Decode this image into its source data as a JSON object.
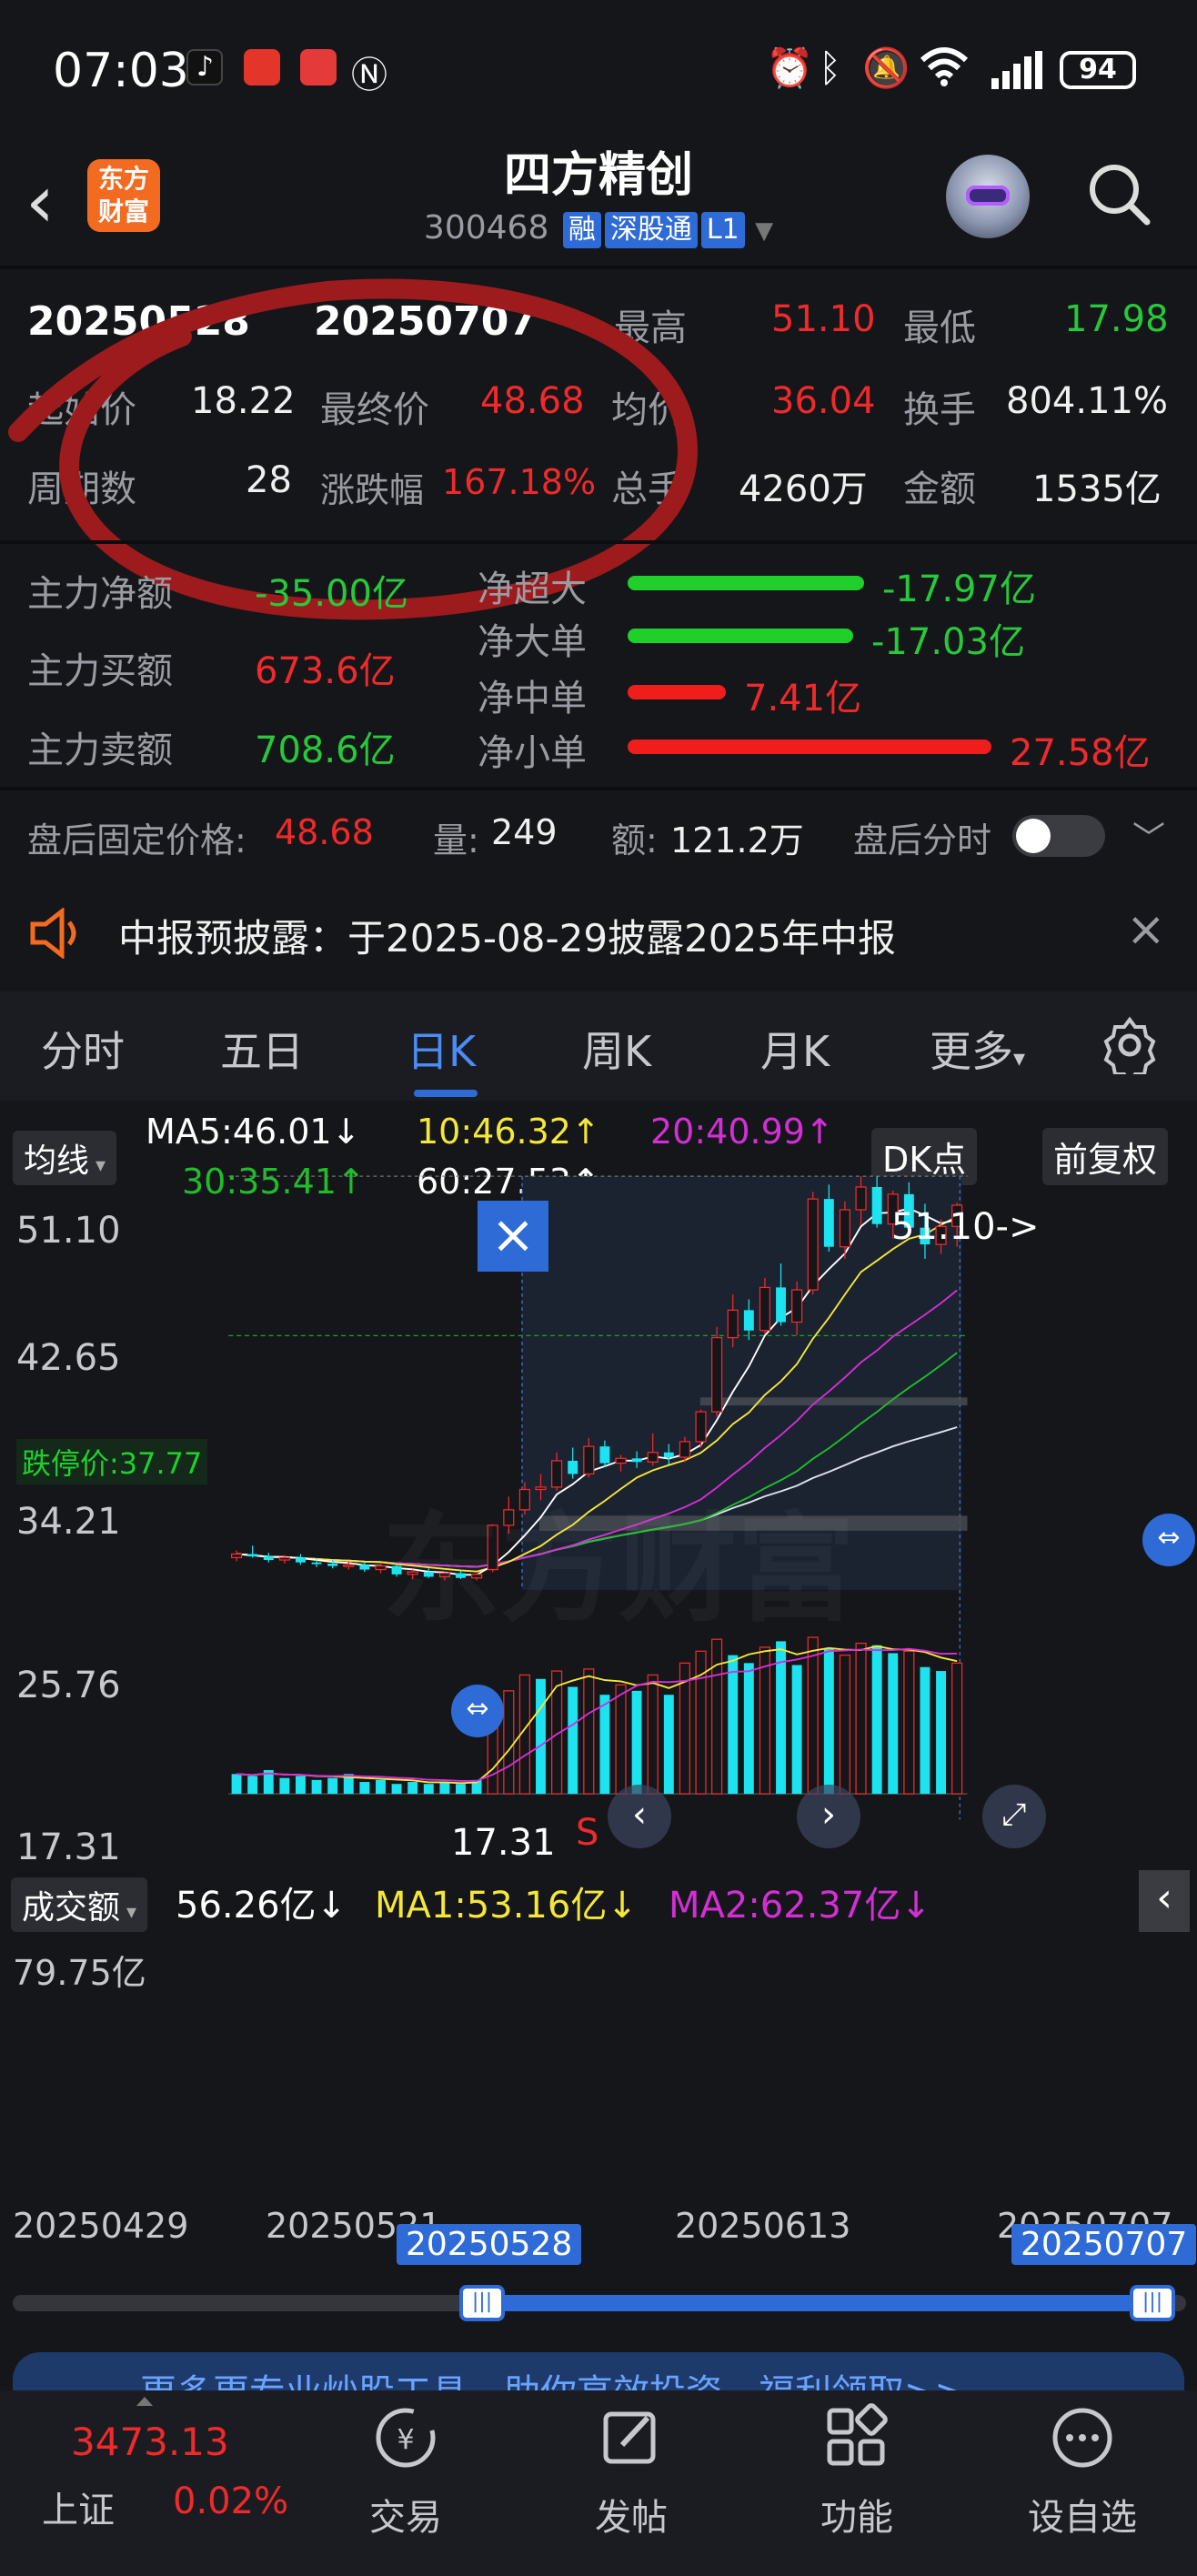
{
  "status_bar": {
    "time": "07:03",
    "battery": "94",
    "icons": [
      "tiktok-icon",
      "huawei-app-icon",
      "red-app-icon",
      "nfc-icon",
      "alarm-icon",
      "bluetooth-icon",
      "mute-icon",
      "wifi-icon",
      "signal-icon"
    ]
  },
  "header": {
    "logo_line1": "东方",
    "logo_line2": "财富",
    "title": "四方精创",
    "code": "300468",
    "tags": [
      "融",
      "深股通",
      "L1"
    ]
  },
  "period_stats": {
    "start_date": "20250528",
    "end_date": "20250707",
    "high_label": "最高",
    "high_value": "51.10",
    "low_label": "最低",
    "low_value": "17.98",
    "start_price_label": "起始价",
    "start_price_value": "18.22",
    "final_price_label": "最终价",
    "final_price_value": "48.68",
    "avg_label": "均价",
    "avg_value": "36.04",
    "turnover_label": "换手",
    "turnover_value": "804.11%",
    "days_label": "周期数",
    "days_value": "28",
    "change_label": "涨跌幅",
    "change_value": "167.18%",
    "volume_label": "总手",
    "volume_value": "4260万",
    "amount_label": "金额",
    "amount_value": "1535亿"
  },
  "capital_flow": {
    "net_label": "主力净额",
    "net_value": "-35.00亿",
    "buy_label": "主力买额",
    "buy_value": "673.6亿",
    "sell_label": "主力卖额",
    "sell_value": "708.6亿",
    "items": [
      {
        "label": "净超大",
        "value": "-17.97亿",
        "color": "#1fd02a",
        "ratio": 0.65
      },
      {
        "label": "净大单",
        "value": "-17.03亿",
        "color": "#1fd02a",
        "ratio": 0.62
      },
      {
        "label": "净中单",
        "value": "7.41亿",
        "color": "#f01d1d",
        "ratio": 0.27
      },
      {
        "label": "净小单",
        "value": "27.58亿",
        "color": "#f01d1d",
        "ratio": 1.0
      }
    ]
  },
  "after_hours": {
    "price_label": "盘后固定价格:",
    "price_value": "48.68",
    "vol_label": "量:",
    "vol_value": "249",
    "amt_label": "额:",
    "amt_value": "121.2万",
    "timeshare_label": "盘后分时"
  },
  "notice": {
    "text": "中报预披露：于2025-08-29披露2025年中报"
  },
  "tabs": [
    "分时",
    "五日",
    "日K",
    "周K",
    "月K",
    "更多"
  ],
  "active_tab": "日K",
  "ma_bar": {
    "mode": "均线",
    "ma5": "MA5:46.01↓",
    "ma10": "10:46.32↑",
    "ma20": "20:40.99↑",
    "ma30": "30:35.41↑",
    "ma60": "60:27.53↑",
    "dk_label": "DK点",
    "adjust_label": "前复权",
    "ma_colors": {
      "ma5": "#ffffff",
      "ma10": "#f5e73a",
      "ma20": "#d42fd6",
      "ma30": "#1fbd2a",
      "ma60": "#ffffff"
    }
  },
  "chart_data": {
    "type": "candlestick",
    "price_axis": [
      "51.10",
      "42.65",
      "34.21",
      "25.76",
      "17.31"
    ],
    "limit_down_label": "跌停价:37.77",
    "high_marker": "51.10->",
    "low_marker": "17.31",
    "sell_marker": "S",
    "watermark": "东方财富",
    "volume_panel": {
      "mode": "成交额",
      "value": "56.26亿↓",
      "ma1": "MA1:53.16亿↓",
      "ma2": "MA2:62.37亿↓",
      "top_label": "79.75亿"
    },
    "x_dates": [
      "20250429",
      "20250521",
      "20250613",
      "20250707"
    ],
    "range_start": "20250528",
    "range_end": "20250707",
    "candles": [
      [
        19.2,
        19.8,
        18.9,
        19.5
      ],
      [
        19.5,
        20.2,
        19.2,
        19.3
      ],
      [
        19.3,
        19.6,
        18.8,
        19.0
      ],
      [
        19.0,
        19.4,
        18.7,
        19.2
      ],
      [
        19.2,
        19.5,
        18.6,
        18.8
      ],
      [
        18.8,
        19.1,
        18.4,
        18.7
      ],
      [
        18.7,
        19.0,
        18.3,
        18.5
      ],
      [
        18.5,
        18.9,
        18.2,
        18.6
      ],
      [
        18.6,
        18.8,
        18.0,
        18.2
      ],
      [
        18.2,
        18.7,
        17.9,
        18.5
      ],
      [
        18.5,
        18.6,
        17.6,
        17.8
      ],
      [
        17.8,
        18.2,
        17.4,
        18.0
      ],
      [
        18.0,
        18.3,
        17.5,
        17.6
      ],
      [
        17.6,
        18.0,
        17.3,
        17.9
      ],
      [
        17.9,
        18.1,
        17.4,
        17.5
      ],
      [
        17.5,
        17.9,
        17.3,
        17.8
      ],
      [
        18.2,
        22.0,
        17.98,
        21.9
      ],
      [
        21.9,
        24.3,
        21.2,
        23.2
      ],
      [
        23.2,
        25.5,
        22.8,
        24.9
      ],
      [
        24.9,
        26.2,
        24.0,
        25.1
      ],
      [
        25.1,
        28.0,
        24.8,
        27.3
      ],
      [
        27.3,
        28.4,
        25.8,
        26.2
      ],
      [
        26.2,
        29.2,
        25.9,
        28.5
      ],
      [
        28.5,
        29.0,
        26.8,
        27.1
      ],
      [
        27.1,
        27.8,
        26.4,
        27.5
      ],
      [
        27.5,
        28.1,
        26.7,
        27.2
      ],
      [
        27.2,
        29.6,
        26.9,
        28.0
      ],
      [
        28.0,
        28.7,
        27.0,
        27.6
      ],
      [
        27.6,
        29.3,
        27.2,
        28.9
      ],
      [
        28.9,
        31.6,
        28.4,
        31.4
      ],
      [
        31.4,
        38.5,
        31.0,
        37.6
      ],
      [
        37.6,
        41.2,
        36.8,
        39.9
      ],
      [
        39.9,
        40.8,
        37.4,
        38.2
      ],
      [
        38.2,
        42.6,
        37.9,
        41.8
      ],
      [
        41.8,
        43.8,
        38.6,
        38.9
      ],
      [
        38.9,
        42.3,
        37.8,
        41.6
      ],
      [
        41.6,
        49.8,
        41.2,
        49.2
      ],
      [
        49.2,
        50.4,
        44.8,
        45.2
      ],
      [
        45.2,
        49.0,
        44.2,
        48.3
      ],
      [
        48.3,
        51.1,
        47.0,
        50.2
      ],
      [
        50.2,
        51.1,
        46.8,
        47.1
      ],
      [
        47.1,
        49.9,
        45.9,
        49.6
      ],
      [
        49.6,
        50.6,
        46.2,
        46.8
      ],
      [
        46.8,
        48.8,
        44.2,
        45.4
      ],
      [
        45.4,
        47.5,
        44.6,
        46.9
      ],
      [
        46.9,
        48.9,
        45.2,
        48.68
      ]
    ],
    "volumes": [
      [
        10,
        0
      ],
      [
        9,
        0
      ],
      [
        12,
        0
      ],
      [
        8,
        0
      ],
      [
        9,
        0
      ],
      [
        7,
        0
      ],
      [
        8,
        0
      ],
      [
        10,
        0
      ],
      [
        6,
        0
      ],
      [
        7,
        0
      ],
      [
        5,
        0
      ],
      [
        6,
        0
      ],
      [
        5,
        0
      ],
      [
        6,
        0
      ],
      [
        5,
        0
      ],
      [
        7,
        0
      ],
      [
        40,
        1
      ],
      [
        52,
        1
      ],
      [
        60,
        1
      ],
      [
        58,
        0
      ],
      [
        62,
        1
      ],
      [
        54,
        0
      ],
      [
        63,
        1
      ],
      [
        50,
        0
      ],
      [
        55,
        1
      ],
      [
        52,
        0
      ],
      [
        60,
        1
      ],
      [
        50,
        0
      ],
      [
        66,
        1
      ],
      [
        72,
        1
      ],
      [
        78,
        1
      ],
      [
        70,
        0
      ],
      [
        66,
        0
      ],
      [
        74,
        1
      ],
      [
        77,
        0
      ],
      [
        65,
        0
      ],
      [
        79,
        1
      ],
      [
        73,
        0
      ],
      [
        70,
        1
      ],
      [
        76,
        1
      ],
      [
        75,
        0
      ],
      [
        71,
        0
      ],
      [
        72,
        1
      ],
      [
        64,
        0
      ],
      [
        62,
        0
      ],
      [
        66,
        1
      ]
    ]
  },
  "bottom_banner": "更多更专业炒股工具，助你高效投资，福利领取>>",
  "index": {
    "name": "上证",
    "value": "3473.13",
    "change": "0.02%"
  },
  "bottom_nav": [
    {
      "label": "交易",
      "icon": "trade-icon"
    },
    {
      "label": "发帖",
      "icon": "post-icon"
    },
    {
      "label": "功能",
      "icon": "apps-icon"
    },
    {
      "label": "设自选",
      "icon": "more-icon"
    }
  ]
}
